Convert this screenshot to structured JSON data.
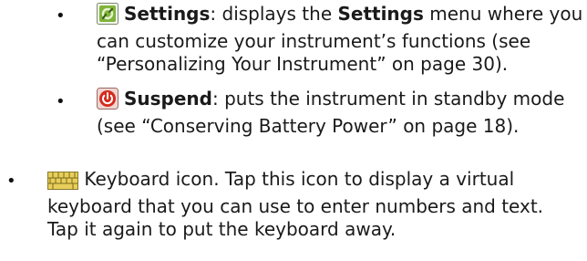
{
  "items": [
    {
      "icon": "settings-icon",
      "term": "Settings",
      "line1_rest_a": ": displays the ",
      "line1_bold": "Settings",
      "line1_rest_b": " menu where you",
      "line2": "can customize your instrument’s functions (see",
      "line3": "“Personalizing Your Instrument” on page 30)."
    },
    {
      "icon": "power-icon",
      "term": "Suspend",
      "line1_rest": ": puts the instrument in standby mode",
      "line2": "(see “Conserving Battery Power” on page 18)."
    },
    {
      "icon": "keyboard-icon",
      "line1_rest": " Keyboard icon. Tap this icon to display a virtual",
      "line2": "keyboard that you can use to enter numbers and text.",
      "line3": "Tap it again to put the keyboard away."
    }
  ],
  "bullet_char": "•",
  "colors": {
    "text": "#1a1a1a",
    "power_red": "#d42b1e",
    "settings_green": "#6aa02a",
    "keyboard_yellow": "#e8cf5a"
  }
}
